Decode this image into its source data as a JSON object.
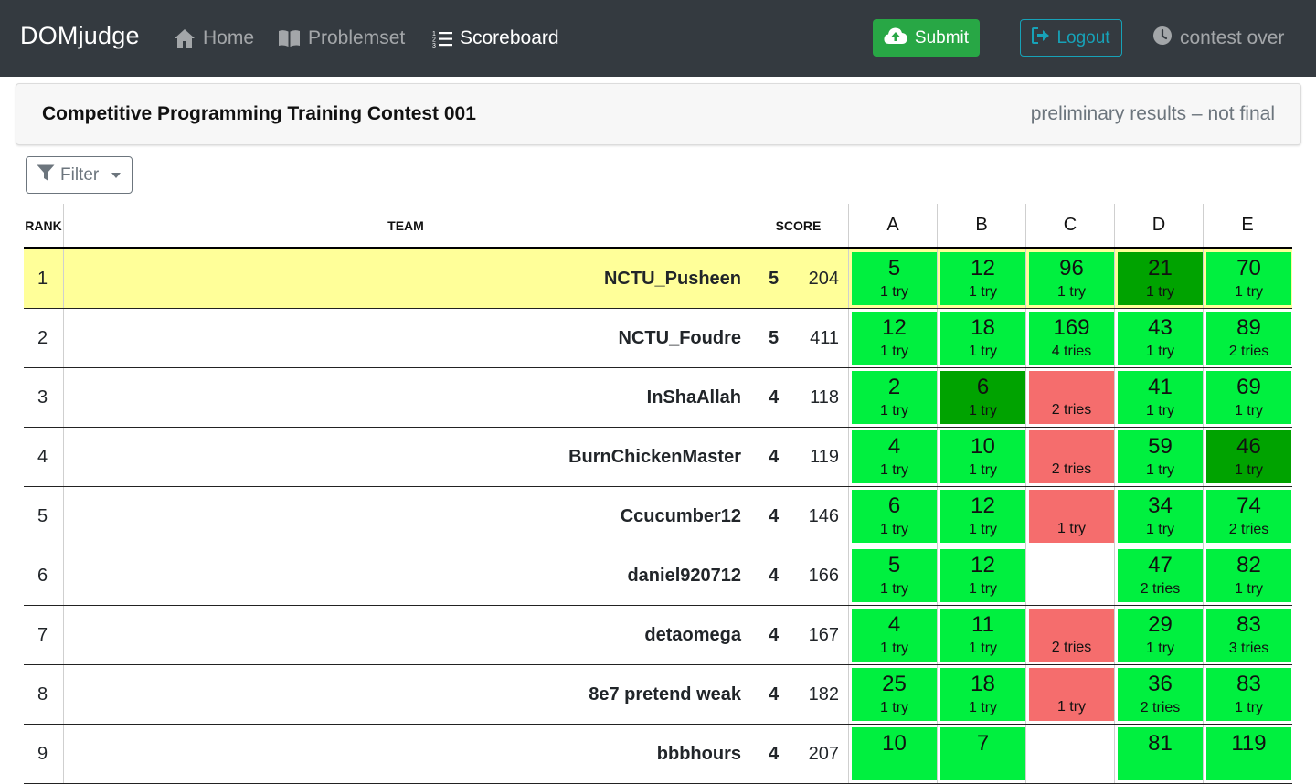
{
  "nav": {
    "brand": "DOMjudge",
    "home": "Home",
    "problemset": "Problemset",
    "scoreboard": "Scoreboard",
    "submit": "Submit",
    "logout": "Logout",
    "contest_status": "contest over"
  },
  "header": {
    "title": "Competitive Programming Training Contest 001",
    "status": "preliminary results – not final"
  },
  "filter": {
    "label": "Filter"
  },
  "table": {
    "headers": {
      "rank": "RANK",
      "team": "TEAM",
      "score": "SCORE"
    },
    "problems": [
      "A",
      "B",
      "C",
      "D",
      "E"
    ],
    "rows": [
      {
        "rank": "1",
        "team": "NCTU_Pusheen",
        "solved": "5",
        "time": "204",
        "highlight": true,
        "cells": [
          {
            "time": "5",
            "tries": "1 try",
            "status": "correct"
          },
          {
            "time": "12",
            "tries": "1 try",
            "status": "correct"
          },
          {
            "time": "96",
            "tries": "1 try",
            "status": "correct"
          },
          {
            "time": "21",
            "tries": "1 try",
            "status": "first"
          },
          {
            "time": "70",
            "tries": "1 try",
            "status": "correct"
          }
        ]
      },
      {
        "rank": "2",
        "team": "NCTU_Foudre",
        "solved": "5",
        "time": "411",
        "highlight": false,
        "cells": [
          {
            "time": "12",
            "tries": "1 try",
            "status": "correct"
          },
          {
            "time": "18",
            "tries": "1 try",
            "status": "correct"
          },
          {
            "time": "169",
            "tries": "4 tries",
            "status": "correct"
          },
          {
            "time": "43",
            "tries": "1 try",
            "status": "correct"
          },
          {
            "time": "89",
            "tries": "2 tries",
            "status": "correct"
          }
        ]
      },
      {
        "rank": "3",
        "team": "InShaAllah",
        "solved": "4",
        "time": "118",
        "highlight": false,
        "cells": [
          {
            "time": "2",
            "tries": "1 try",
            "status": "correct"
          },
          {
            "time": "6",
            "tries": "1 try",
            "status": "first"
          },
          {
            "time": "",
            "tries": "2 tries",
            "status": "incorrect"
          },
          {
            "time": "41",
            "tries": "1 try",
            "status": "correct"
          },
          {
            "time": "69",
            "tries": "1 try",
            "status": "correct"
          }
        ]
      },
      {
        "rank": "4",
        "team": "BurnChickenMaster",
        "solved": "4",
        "time": "119",
        "highlight": false,
        "cells": [
          {
            "time": "4",
            "tries": "1 try",
            "status": "correct"
          },
          {
            "time": "10",
            "tries": "1 try",
            "status": "correct"
          },
          {
            "time": "",
            "tries": "2 tries",
            "status": "incorrect"
          },
          {
            "time": "59",
            "tries": "1 try",
            "status": "correct"
          },
          {
            "time": "46",
            "tries": "1 try",
            "status": "first"
          }
        ]
      },
      {
        "rank": "5",
        "team": "Ccucumber12",
        "solved": "4",
        "time": "146",
        "highlight": false,
        "cells": [
          {
            "time": "6",
            "tries": "1 try",
            "status": "correct"
          },
          {
            "time": "12",
            "tries": "1 try",
            "status": "correct"
          },
          {
            "time": "",
            "tries": "1 try",
            "status": "incorrect"
          },
          {
            "time": "34",
            "tries": "1 try",
            "status": "correct"
          },
          {
            "time": "74",
            "tries": "2 tries",
            "status": "correct"
          }
        ]
      },
      {
        "rank": "6",
        "team": "daniel920712",
        "solved": "4",
        "time": "166",
        "highlight": false,
        "cells": [
          {
            "time": "5",
            "tries": "1 try",
            "status": "correct"
          },
          {
            "time": "12",
            "tries": "1 try",
            "status": "correct"
          },
          {
            "time": "",
            "tries": "",
            "status": "empty"
          },
          {
            "time": "47",
            "tries": "2 tries",
            "status": "correct"
          },
          {
            "time": "82",
            "tries": "1 try",
            "status": "correct"
          }
        ]
      },
      {
        "rank": "7",
        "team": "detaomega",
        "solved": "4",
        "time": "167",
        "highlight": false,
        "cells": [
          {
            "time": "4",
            "tries": "1 try",
            "status": "correct"
          },
          {
            "time": "11",
            "tries": "1 try",
            "status": "correct"
          },
          {
            "time": "",
            "tries": "2 tries",
            "status": "incorrect"
          },
          {
            "time": "29",
            "tries": "1 try",
            "status": "correct"
          },
          {
            "time": "83",
            "tries": "3 tries",
            "status": "correct"
          }
        ]
      },
      {
        "rank": "8",
        "team": "8e7 pretend weak",
        "solved": "4",
        "time": "182",
        "highlight": false,
        "cells": [
          {
            "time": "25",
            "tries": "1 try",
            "status": "correct"
          },
          {
            "time": "18",
            "tries": "1 try",
            "status": "correct"
          },
          {
            "time": "",
            "tries": "1 try",
            "status": "incorrect"
          },
          {
            "time": "36",
            "tries": "2 tries",
            "status": "correct"
          },
          {
            "time": "83",
            "tries": "1 try",
            "status": "correct"
          }
        ]
      },
      {
        "rank": "9",
        "team": "bbbhours",
        "solved": "4",
        "time": "207",
        "highlight": false,
        "cells": [
          {
            "time": "10",
            "tries": "",
            "status": "correct"
          },
          {
            "time": "7",
            "tries": "",
            "status": "correct"
          },
          {
            "time": "",
            "tries": "",
            "status": "empty"
          },
          {
            "time": "81",
            "tries": "",
            "status": "correct"
          },
          {
            "time": "119",
            "tries": "",
            "status": "correct"
          }
        ]
      }
    ]
  },
  "colors": {
    "navbar": "#343a40",
    "correct": "#00f03f",
    "first_solve": "#00a300",
    "incorrect": "#f56d6d",
    "highlight_row": "#ffff99",
    "submit_button": "#28a745",
    "logout_button": "#17a2b8"
  },
  "icons": {
    "home": "home-icon",
    "problemset": "book-icon",
    "scoreboard": "list-icon",
    "submit": "cloud-upload-icon",
    "logout": "sign-out-icon",
    "status": "clock-icon",
    "filter": "funnel-icon"
  }
}
